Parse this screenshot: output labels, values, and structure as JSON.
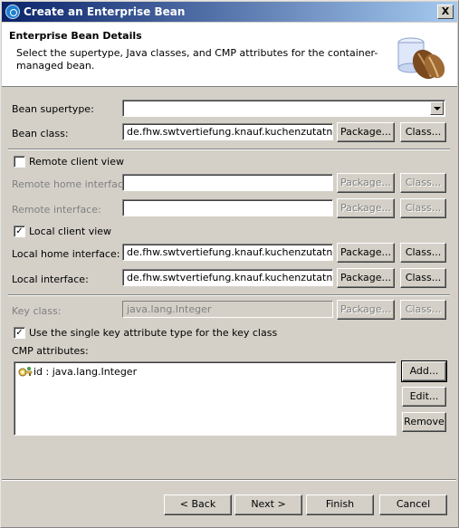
{
  "window": {
    "title": "Create an Enterprise Bean",
    "close_label": "X"
  },
  "header": {
    "title": "Enterprise Bean Details",
    "description": "Select the supertype, Java classes, and CMP attributes for the container-managed bean."
  },
  "form": {
    "bean_supertype": {
      "label": "Bean supertype:",
      "value": ""
    },
    "bean_class": {
      "label": "Bean class:",
      "value": "de.fhw.swtvertiefung.knauf.kuchenzutatnm.Z",
      "package_label": "Package...",
      "class_label": "Class..."
    },
    "remote_client_view": {
      "label": "Remote client view",
      "checked": false
    },
    "remote_home_interface": {
      "label": "Remote home interface:",
      "value": "",
      "package_label": "Package...",
      "class_label": "Class..."
    },
    "remote_interface": {
      "label": "Remote interface:",
      "value": "",
      "package_label": "Package...",
      "class_label": "Class..."
    },
    "local_client_view": {
      "label": "Local client view",
      "checked": true
    },
    "local_home_interface": {
      "label": "Local home interface:",
      "value": "de.fhw.swtvertiefung.knauf.kuchenzutatnm.Z",
      "package_label": "Package...",
      "class_label": "Class..."
    },
    "local_interface": {
      "label": "Local interface:",
      "value": "de.fhw.swtvertiefung.knauf.kuchenzutatnm.Z",
      "package_label": "Package...",
      "class_label": "Class..."
    },
    "key_class": {
      "label": "Key class:",
      "value": "java.lang.Integer",
      "package_label": "Package...",
      "class_label": "Class..."
    },
    "single_key": {
      "label": "Use the single key attribute type for the key class",
      "checked": true
    },
    "cmp_attributes": {
      "label": "CMP attributes:",
      "items": [
        "id : java.lang.Integer"
      ],
      "add_label": "Add...",
      "edit_label": "Edit...",
      "remove_label": "Remove"
    }
  },
  "footer": {
    "back_label": "< Back",
    "next_label": "Next >",
    "finish_label": "Finish",
    "cancel_label": "Cancel"
  },
  "icons": {
    "title": "eclipse-icon",
    "header": "enterprise-bean-wizard-icon",
    "key": "key-attribute-icon",
    "check": "checkmark"
  }
}
